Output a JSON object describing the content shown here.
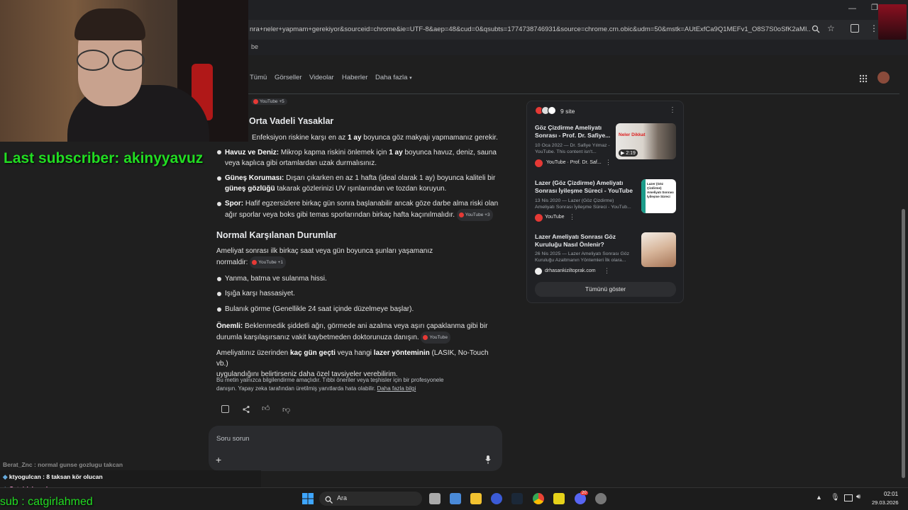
{
  "browser": {
    "url": "nra+neler+yapmam+gerekiyor&sourceid=chrome&ie=UTF-8&aep=48&cud=0&qsubts=1774738746931&source=chrome.crn.obic&udm=50&mstk=AUtExfCa9Q1MEFv1_O8S7S0oSfK2aMI...",
    "bookmark_fragment": "be"
  },
  "nav": {
    "tabs": [
      "Tümü",
      "Görseller",
      "Videolar",
      "Haberler",
      "Daha fazla"
    ]
  },
  "overview": {
    "top_chip": "YouTube +5",
    "section1_title": "Orta Vadeli Yasaklar",
    "line_makeup_pre": "Enfeksiyon riskine karşı en az ",
    "line_makeup_bold": "1 ay",
    "line_makeup_post": " boyunca göz makyajı yapmamanız gerekir.",
    "b1_label": "Havuz ve Deniz:",
    "b1_pre": " Mikrop kapma riskini önlemek için ",
    "b1_bold": "1 ay",
    "b1_post": " boyunca havuz, deniz, sauna",
    "b1_line2": "veya kaplıca gibi ortamlardan uzak durmalısınız.",
    "b2_label": "Güneş Koruması:",
    "b2_text": " Dışarı çıkarken en az 1 hafta (ideal olarak 1 ay) boyunca kaliteli bir",
    "b2_bold": "güneş gözlüğü",
    "b2_post": " takarak gözlerinizi UV ışınlarından ve tozdan koruyun.",
    "b3_label": "Spor:",
    "b3_text": " Hafif egzersizlere birkaç gün sonra başlanabilir ancak göze darbe alma riski olan",
    "b3_line2": "ağır sporlar veya boks gibi temas sporlarından birkaç hafta kaçınılmalıdır.",
    "b3_chip": "YouTube +3",
    "section2_title": "Normal Karşılanan Durumlar",
    "normal_intro1": "Ameliyat sonrası ilk birkaç saat veya gün boyunca şunları yaşamanız",
    "normal_intro2": "normaldir:",
    "normal_chip": "YouTube +1",
    "n1": "Yanma, batma ve sulanma hissi.",
    "n2": "Işığa karşı hassasiyet.",
    "n3": "Bulanık görme (Genellikle 24 saat içinde düzelmeye başlar).",
    "important_label": "Önemli:",
    "important_text": " Beklenmedik şiddetli ağrı, görmede ani azalma veya aşırı çapaklanma gibi bir",
    "important_line2": "durumla karşılaşırsanız vakit kaybetmeden doktorunuza danışın.",
    "important_chip": "YouTube",
    "followup_pre": "Ameliyatınız üzerinden ",
    "followup_b1": "kaç gün geçti",
    "followup_mid": " veya hangi ",
    "followup_b2": "lazer yönteminin",
    "followup_post": " (LASIK, No-Touch vb.)",
    "followup_line2": "uygulandığını belirtirseniz daha özel tavsiyeler verebilirim.",
    "disclaimer1": "Bu metin yalnızca bilgilendirme amaçlıdır. Tıbbi öneriler veya teşhisler için bir profesyonele",
    "disclaimer2": "danışın. Yapay zeka tarafından üretilmiş yanıtlarda hata olabilir.",
    "disclaimer_link": "Daha fazla bilgi",
    "ask_placeholder": "Soru sorun"
  },
  "sources": {
    "count_label": "9 site",
    "items": [
      {
        "title": "Göz Çizdirme Ameliyatı Sonrası - Prof. Dr. Safiye...",
        "desc1": "10 Oca 2022 — Dr. Safiye Yılmaz -",
        "desc2": "YouTube. This content isn't...",
        "site": "YouTube · Prof. Dr. Saf...",
        "duration": "2:19",
        "thumb_text": "Neler Dikkat"
      },
      {
        "title": "Lazer (Göz Çizdirme) Ameliyatı Sonrası İyileşme Süreci - YouTube",
        "desc1": "13 Nis 2020 — Lazer (Göz Çizdirme)",
        "desc2": "Ameliyatı Sonrası İyileşme Süreci - YouTub...",
        "site": "YouTube",
        "thumb_text": "Lazer (Göz Çizdirme) Ameliyatı Sonrası İyileşme Süreci"
      },
      {
        "title": "Lazer Ameliyatı Sonrası Göz Kuruluğu Nasıl Önlenir?",
        "desc1": "26 Nis 2025 — Lazer Ameliyatı Sonrası Göz",
        "desc2": "Kuruluğu Azaltmanın Yöntemleri İlk olara...",
        "site": "drhasankiziltoprak.com"
      }
    ],
    "show_all": "Tümünü göster"
  },
  "overlay": {
    "last_subscriber": "Last subscriber: akinyyavuz",
    "chat": [
      {
        "user": "Berat_Znc",
        "text": " : normal gunse gozlugu takcan",
        "color": "#8a8a8a"
      },
      {
        "user": "ktyogulcan",
        "text": " : 8 taksan kör olucan",
        "color": "#ffffff"
      },
      {
        "user": "Catgirlahmed",
        "text": " :",
        "color": "#ff9bd6"
      }
    ],
    "follow_ticker": "sub : catgirlahmed",
    "accent_green": "#22dd22"
  },
  "taskbar": {
    "search_label": "Ara",
    "time": "02:01",
    "date": "29.03.2026",
    "badge": "20"
  }
}
